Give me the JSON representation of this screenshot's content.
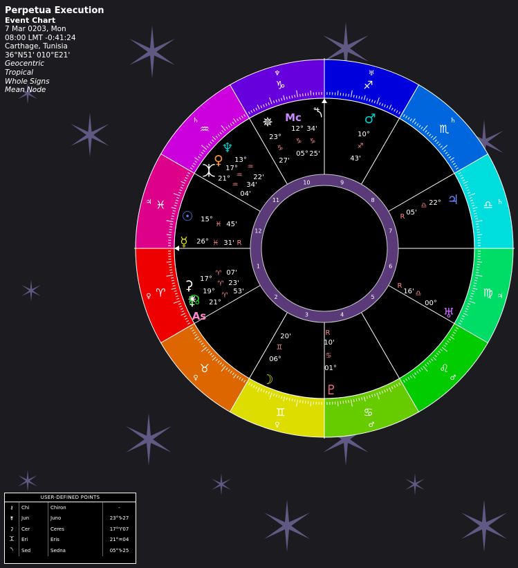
{
  "chart": {
    "name": "Perpetua Execution",
    "type": "Event Chart",
    "date": "7 Mar 0203, Mon",
    "time": "08:00  LMT -0:41:24",
    "place": "Carthage, Tunisia",
    "coords": "36°N51' 010°E21'",
    "options": [
      "Geocentric",
      "Tropical",
      "Whole Signs",
      "Mean Node"
    ]
  },
  "colors": {
    "background": "#1c1b1f",
    "star": "#6b6496",
    "wheel_inner": "#000000",
    "house_ring": "#5a3a78",
    "aries": "#ee0000",
    "taurus": "#dd6600",
    "gemini": "#dddd00",
    "cancer": "#66cc00",
    "leo": "#00cc00",
    "virgo": "#00dd66",
    "libra": "#00dddd",
    "scorpio": "#0066dd",
    "sagittarius": "#0000dd",
    "capricorn": "#6600dd",
    "aquarius": "#cc00dd",
    "pisces": "#dd0088"
  },
  "zodiac": [
    {
      "sign": "aries",
      "glyph": "♈",
      "ruler": "♀"
    },
    {
      "sign": "taurus",
      "glyph": "♉",
      "ruler": "♀"
    },
    {
      "sign": "gemini",
      "glyph": "♊",
      "ruler": "♀"
    },
    {
      "sign": "cancer",
      "glyph": "♋",
      "ruler": "♂"
    },
    {
      "sign": "leo",
      "glyph": "♌",
      "ruler": "♂"
    },
    {
      "sign": "virgo",
      "glyph": "♍",
      "ruler": "♃"
    },
    {
      "sign": "libra",
      "glyph": "♎",
      "ruler": "♄"
    },
    {
      "sign": "scorpio",
      "glyph": "♏",
      "ruler": "♄"
    },
    {
      "sign": "sagittarius",
      "glyph": "♐",
      "ruler": "♅"
    },
    {
      "sign": "capricorn",
      "glyph": "♑",
      "ruler": "♆"
    },
    {
      "sign": "aquarius",
      "glyph": "♒",
      "ruler": "♄"
    },
    {
      "sign": "pisces",
      "glyph": "♓",
      "ruler": "♃"
    }
  ],
  "houses": [
    "1",
    "2",
    "3",
    "4",
    "5",
    "6",
    "7",
    "8",
    "9",
    "10",
    "11",
    "12"
  ],
  "planets": [
    {
      "name": "Sun",
      "glyph": "☉",
      "deg": "15°",
      "sign": "♓",
      "min": "45'",
      "color": "#5588ff",
      "retro": ""
    },
    {
      "name": "Mercury",
      "glyph": "☿",
      "deg": "26°",
      "sign": "♓",
      "min": "31'",
      "color": "#dddd00",
      "retro": "R"
    },
    {
      "name": "Ceres",
      "glyph": "⚳",
      "deg": "17°",
      "sign": "♈",
      "min": "07'",
      "color": "#ffffff",
      "retro": ""
    },
    {
      "name": "Juno",
      "glyph": "⚵",
      "deg": "19°",
      "sign": "♈",
      "min": "23'",
      "color": "#ffffff",
      "retro": ""
    },
    {
      "name": "Node",
      "glyph": "☊",
      "deg": "21°",
      "sign": "♈",
      "min": "53'",
      "color": "#22cc22",
      "retro": ""
    },
    {
      "name": "Ascendant",
      "glyph": "As",
      "deg": "",
      "sign": "",
      "min": "",
      "color": "#ff88cc",
      "retro": ""
    },
    {
      "name": "Moon",
      "glyph": "☽",
      "deg": "20'",
      "sign": "♊",
      "min": "06°",
      "color": "#dddd00",
      "retro": ""
    },
    {
      "name": "Pluto",
      "glyph": "♇",
      "deg": "10'",
      "sign": "♋",
      "min": "01°",
      "color": "#ff6688",
      "retro": "R"
    },
    {
      "name": "Uranus",
      "glyph": "♅",
      "deg": "16'",
      "sign": "♎",
      "min": "00°",
      "color": "#cc66ff",
      "retro": "R"
    },
    {
      "name": "Jupiter",
      "glyph": "♃",
      "deg": "22°",
      "sign": "♎",
      "min": "05'",
      "color": "#6688ff",
      "retro": "R"
    },
    {
      "name": "Mars",
      "glyph": "♂",
      "deg": "10°",
      "sign": "♐",
      "min": "43'",
      "color": "#00cccc",
      "retro": ""
    },
    {
      "name": "Midheaven",
      "glyph": "Mc",
      "deg": "12°",
      "sign": "♑",
      "min": "05°",
      "color": "#cc88ff",
      "retro": ""
    },
    {
      "name": "Sedna",
      "glyph": "⯲",
      "deg": "34'",
      "sign": "♑",
      "min": "25'",
      "color": "#ffffff",
      "retro": ""
    },
    {
      "name": "Juno2",
      "glyph": "✵",
      "deg": "23°",
      "sign": "♑",
      "min": "27'",
      "color": "#ffffff",
      "retro": ""
    },
    {
      "name": "Neptune",
      "glyph": "♆",
      "deg": "13°",
      "sign": "♒",
      "min": "22'",
      "color": "#00cccc",
      "retro": ""
    },
    {
      "name": "Venus",
      "glyph": "♀",
      "deg": "17°",
      "sign": "♒",
      "min": "34'",
      "color": "#ff9933",
      "retro": ""
    },
    {
      "name": "Eris",
      "glyph": "⯰",
      "deg": "21°",
      "sign": "♒",
      "min": "04'",
      "color": "#ffffff",
      "retro": ""
    }
  ],
  "udp": {
    "caption": "USER-DEFINED POINTS",
    "rows": [
      {
        "glyph": "⚷",
        "abbr": "Chi",
        "name": "Chiron",
        "pos": "-"
      },
      {
        "glyph": "⚵",
        "abbr": "Jun",
        "name": "Juno",
        "pos": "23°♑27"
      },
      {
        "glyph": "⚳",
        "abbr": "Cer",
        "name": "Ceres",
        "pos": "17°♈07"
      },
      {
        "glyph": "⯰",
        "abbr": "Eri",
        "name": "Eris",
        "pos": "21°♒04"
      },
      {
        "glyph": "⯲",
        "abbr": "Sed",
        "name": "Sedna",
        "pos": "05°♑25"
      }
    ]
  }
}
